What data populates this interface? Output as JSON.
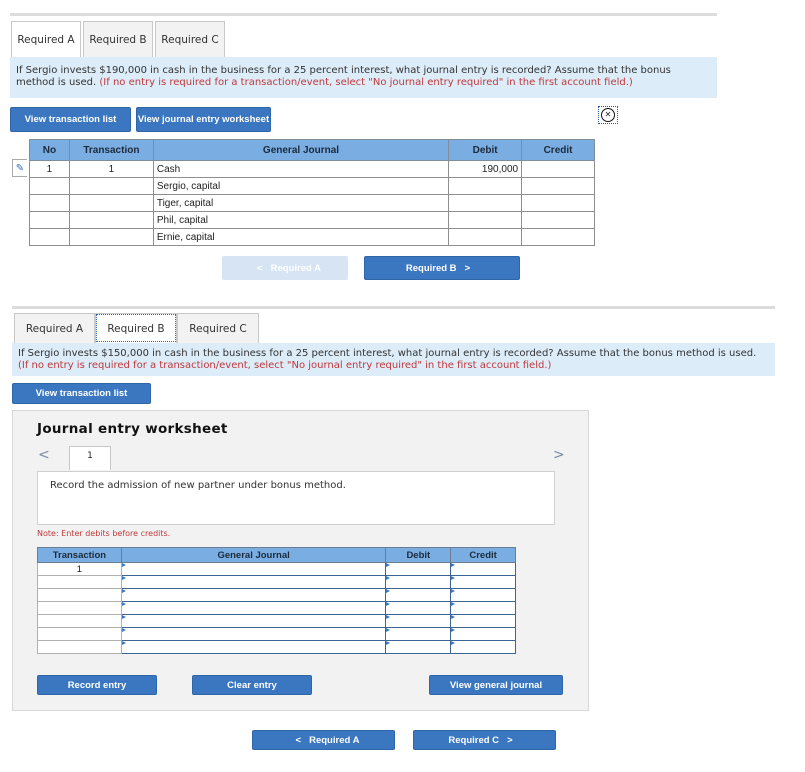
{
  "partA": {
    "tabs": [
      {
        "label": "Required A",
        "state": "active"
      },
      {
        "label": "Required B",
        "state": "inactive"
      },
      {
        "label": "Required C",
        "state": "inactive"
      }
    ],
    "question": "If Sergio invests $190,000 in cash in the business for a 25 percent interest, what journal entry is recorded? Assume that the bonus method is used.",
    "instruction": "(If no entry is required for a transaction/event, select \"No journal entry required\" in the first account field.)",
    "buttons": {
      "view_transaction_list": "View transaction list",
      "view_journal_entry_worksheet": "View journal entry worksheet"
    },
    "close_icon": "circle-x-icon",
    "edit_icon": "pencil-icon",
    "table": {
      "headers": [
        "No",
        "Transaction",
        "General Journal",
        "Debit",
        "Credit"
      ],
      "rows": [
        {
          "no": "1",
          "transaction": "1",
          "account": "Cash",
          "debit": "190,000",
          "credit": ""
        },
        {
          "no": "",
          "transaction": "",
          "account": "Sergio, capital",
          "debit": "",
          "credit": ""
        },
        {
          "no": "",
          "transaction": "",
          "account": "Tiger, capital",
          "debit": "",
          "credit": ""
        },
        {
          "no": "",
          "transaction": "",
          "account": "Phil, capital",
          "debit": "",
          "credit": ""
        },
        {
          "no": "",
          "transaction": "",
          "account": "Ernie, capital",
          "debit": "",
          "credit": ""
        }
      ]
    },
    "nav": {
      "prev_label": "Required A",
      "prev_enabled": false,
      "next_label": "Required B"
    }
  },
  "partB": {
    "tabs": [
      {
        "label": "Required A",
        "state": "inactive"
      },
      {
        "label": "Required B",
        "state": "active-focused"
      },
      {
        "label": "Required C",
        "state": "inactive"
      }
    ],
    "question": "If Sergio invests $150,000 in cash in the business for a 25 percent interest, what journal entry is recorded? Assume that the bonus method is used.",
    "instruction": "(If no entry is required for a transaction/event, select \"No journal entry required\" in the first account field.)",
    "buttons": {
      "view_transaction_list": "View transaction list"
    },
    "worksheet": {
      "title": "Journal entry worksheet",
      "prev_arrow": "<",
      "next_arrow": ">",
      "active_tab": "1",
      "description": "Record the admission of new partner under bonus method.",
      "note": "Note: Enter debits before credits.",
      "headers": [
        "Transaction",
        "General Journal",
        "Debit",
        "Credit"
      ],
      "rows": [
        {
          "transaction": "1",
          "account": "",
          "debit": "",
          "credit": ""
        },
        {
          "transaction": "",
          "account": "",
          "debit": "",
          "credit": ""
        },
        {
          "transaction": "",
          "account": "",
          "debit": "",
          "credit": ""
        },
        {
          "transaction": "",
          "account": "",
          "debit": "",
          "credit": ""
        },
        {
          "transaction": "",
          "account": "",
          "debit": "",
          "credit": ""
        },
        {
          "transaction": "",
          "account": "",
          "debit": "",
          "credit": ""
        },
        {
          "transaction": "",
          "account": "",
          "debit": "",
          "credit": ""
        }
      ],
      "buttons": {
        "record_entry": "Record entry",
        "clear_entry": "Clear entry",
        "view_general_journal": "View general journal"
      }
    },
    "nav": {
      "prev_label": "Required A",
      "next_label": "Required C"
    }
  },
  "colors": {
    "accent_blue": "#3a77c0",
    "header_blue": "#7aaee3",
    "question_bg": "#dcecf9",
    "instruction_red": "#c0393b"
  }
}
